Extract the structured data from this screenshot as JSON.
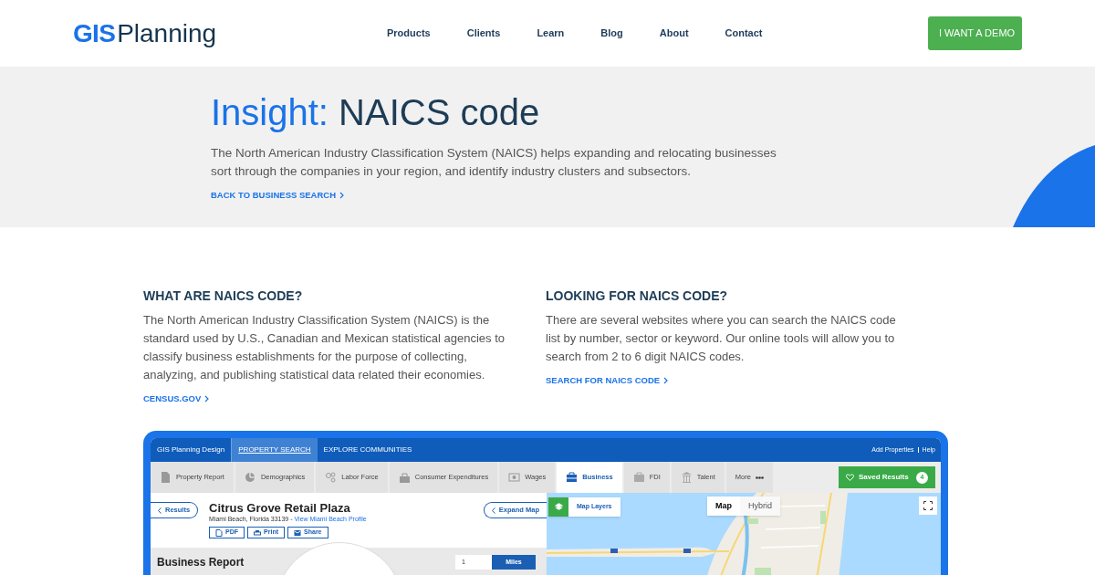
{
  "header": {
    "logo": {
      "mark": "GIS",
      "word": "Planning"
    },
    "nav": [
      {
        "label": "Products"
      },
      {
        "label": "Clients"
      },
      {
        "label": "Learn"
      },
      {
        "label": "Blog"
      },
      {
        "label": "About"
      },
      {
        "label": "Contact"
      }
    ],
    "cta": "I WANT A DEMO"
  },
  "hero": {
    "title_prefix": "Insight:",
    "title": "NAICS code",
    "description": "The North American Industry Classification System (NAICS) helps expanding and relocating businesses sort through the companies in your region, and identify industry clusters and subsectors.",
    "link": "BACK TO BUSINESS SEARCH"
  },
  "sections": [
    {
      "heading": "WHAT ARE NAICS CODE?",
      "body": "The North American Industry Classification System (NAICS) is the standard used by U.S., Canadian and Mexican statistical agencies to classify business establishments for the purpose of collecting, analyzing, and publishing statistical data related their economies.",
      "link": "CENSUS.GOV"
    },
    {
      "heading": "LOOKING FOR NAICS CODE?",
      "body": "There are several websites where you can search the NAICS code list by number, sector or keyword. Our online tools will allow you to search from 2 to 6 digit NAICS codes.",
      "link": "SEARCH FOR NAICS CODE"
    }
  ],
  "app_preview": {
    "top_nav": [
      {
        "label": "GIS Planning Design",
        "selected": false
      },
      {
        "label": "PROPERTY SEARCH",
        "selected": true
      },
      {
        "label": "EXPLORE COMMUNITIES",
        "selected": false
      }
    ],
    "top_links": [
      "Add Properties",
      "Help"
    ],
    "tabs": [
      {
        "label": "Property Report",
        "selected": false
      },
      {
        "label": "Demographics",
        "selected": false
      },
      {
        "label": "Labor Force",
        "selected": false
      },
      {
        "label": "Consumer Expenditures",
        "selected": false
      },
      {
        "label": "Wages",
        "selected": false
      },
      {
        "label": "Business",
        "selected": true
      },
      {
        "label": "FDI",
        "selected": false
      },
      {
        "label": "Talent",
        "selected": false
      },
      {
        "label": "More",
        "selected": false
      }
    ],
    "saved_results": {
      "label": "Saved Results",
      "count": "4"
    },
    "property": {
      "back": "Results",
      "name": "Citrus Grove Retail Plaza",
      "address": "Miami Beach, Florida 33139 -",
      "profile_link": "View Miami Beach Profile",
      "expand": "Expand Map",
      "actions": [
        "PDF",
        "Print",
        "Share"
      ]
    },
    "report": {
      "title": "Business Report",
      "distance": "1",
      "unit": "Miles"
    },
    "map": {
      "layers_button": "Map Layers",
      "types": [
        {
          "label": "Map",
          "selected": true
        },
        {
          "label": "Hybrid",
          "selected": false
        }
      ]
    }
  }
}
